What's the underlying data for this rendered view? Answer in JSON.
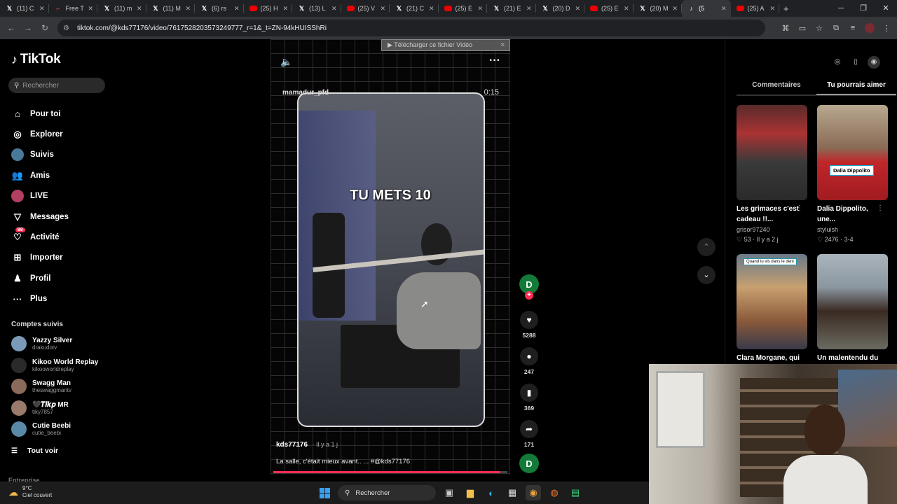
{
  "browser": {
    "tabs": [
      {
        "title": "(11) C",
        "icon": "x"
      },
      {
        "title": "Free T",
        "icon": "other"
      },
      {
        "title": "(11) m",
        "icon": "x"
      },
      {
        "title": "(11) M",
        "icon": "x"
      },
      {
        "title": "(6) rs",
        "icon": "x"
      },
      {
        "title": "(25) H",
        "icon": "yt"
      },
      {
        "title": "(13) L",
        "icon": "x"
      },
      {
        "title": "(25) V",
        "icon": "yt"
      },
      {
        "title": "(21) C",
        "icon": "x"
      },
      {
        "title": "(25) E",
        "icon": "yt"
      },
      {
        "title": "(21) E",
        "icon": "x"
      },
      {
        "title": "(20) D",
        "icon": "x"
      },
      {
        "title": "(25) E",
        "icon": "yt"
      },
      {
        "title": "(20) M",
        "icon": "x"
      },
      {
        "title": "(5",
        "icon": "tt",
        "active": true
      },
      {
        "title": "(25) A",
        "icon": "yt"
      }
    ],
    "url": "tiktok.com/@kds77176/video/7617528203573249777_r=1&_t=ZN-94kHUISShRi"
  },
  "sidebar": {
    "brand": "TikTok",
    "search_placeholder": "Rechercher",
    "nav": [
      {
        "label": "Pour toi",
        "icon": "home-icon"
      },
      {
        "label": "Explorer",
        "icon": "compass-icon"
      },
      {
        "label": "Suivis",
        "icon": "following-avatar"
      },
      {
        "label": "Amis",
        "icon": "friends-icon"
      },
      {
        "label": "LIVE",
        "icon": "live-avatar"
      },
      {
        "label": "Messages",
        "icon": "messages-icon"
      },
      {
        "label": "Activité",
        "icon": "activity-icon",
        "badge": "99"
      },
      {
        "label": "Importer",
        "icon": "upload-icon"
      },
      {
        "label": "Profil",
        "icon": "profile-icon"
      },
      {
        "label": "Plus",
        "icon": "more-icon"
      }
    ],
    "following_title": "Comptes suivis",
    "following": [
      {
        "name": "Yazzy Silver",
        "handle": "drakudotv",
        "color": "#7a9ab8"
      },
      {
        "name": "Kikoo World Replay",
        "handle": "kikooworldreplay",
        "color": "#2a2a2a"
      },
      {
        "name": "Swagg Man",
        "handle": "theswaggmantv",
        "color": "#8a6a5a"
      },
      {
        "name": "🖤𝑻𝒊𝒌𝒑 MR",
        "handle": "tiky7857",
        "color": "#9a7a6a"
      },
      {
        "name": "Cutie Beebi",
        "handle": "cutie_beebi",
        "color": "#5a8aa8"
      }
    ],
    "see_all": "Tout voir",
    "company": "Entreprise"
  },
  "video": {
    "download_bar": "Télécharger ce fichier Vidéo",
    "username_overlay": "mamadur_pfd",
    "duration": "0:15",
    "overlay_text": "TU METS 10",
    "author": "kds77176",
    "posted": "Il y a 1 j",
    "caption": "La salle, c'était mieux avant.. ... #@kds77176",
    "progress_fraction": 0.97
  },
  "actions": {
    "creator_initial": "D",
    "likes": "5288",
    "comments": "247",
    "saves": "369",
    "shares": "171",
    "bottom_initial": "D"
  },
  "right_panel": {
    "tabs": [
      "Commentaires",
      "Tu pourrais aimer"
    ],
    "active_tab": 1,
    "cards": [
      {
        "title": "Les grimaces c'est cadeau !!...",
        "author": "grisor97240",
        "likes": "53",
        "date": "Il y a 2 j"
      },
      {
        "title": "Dalia Dippolito, une...",
        "author": "styluish",
        "likes": "2476",
        "date": "3-4",
        "badge": "Dalia Dippolito"
      },
      {
        "title": "Clara Morgane, qui",
        "badge": "Quand tu vis dans le deni"
      },
      {
        "title": "Un malentendu du"
      }
    ]
  },
  "taskbar": {
    "weather_temp": "9°C",
    "weather_desc": "Ciel couvert",
    "search": "Rechercher"
  }
}
